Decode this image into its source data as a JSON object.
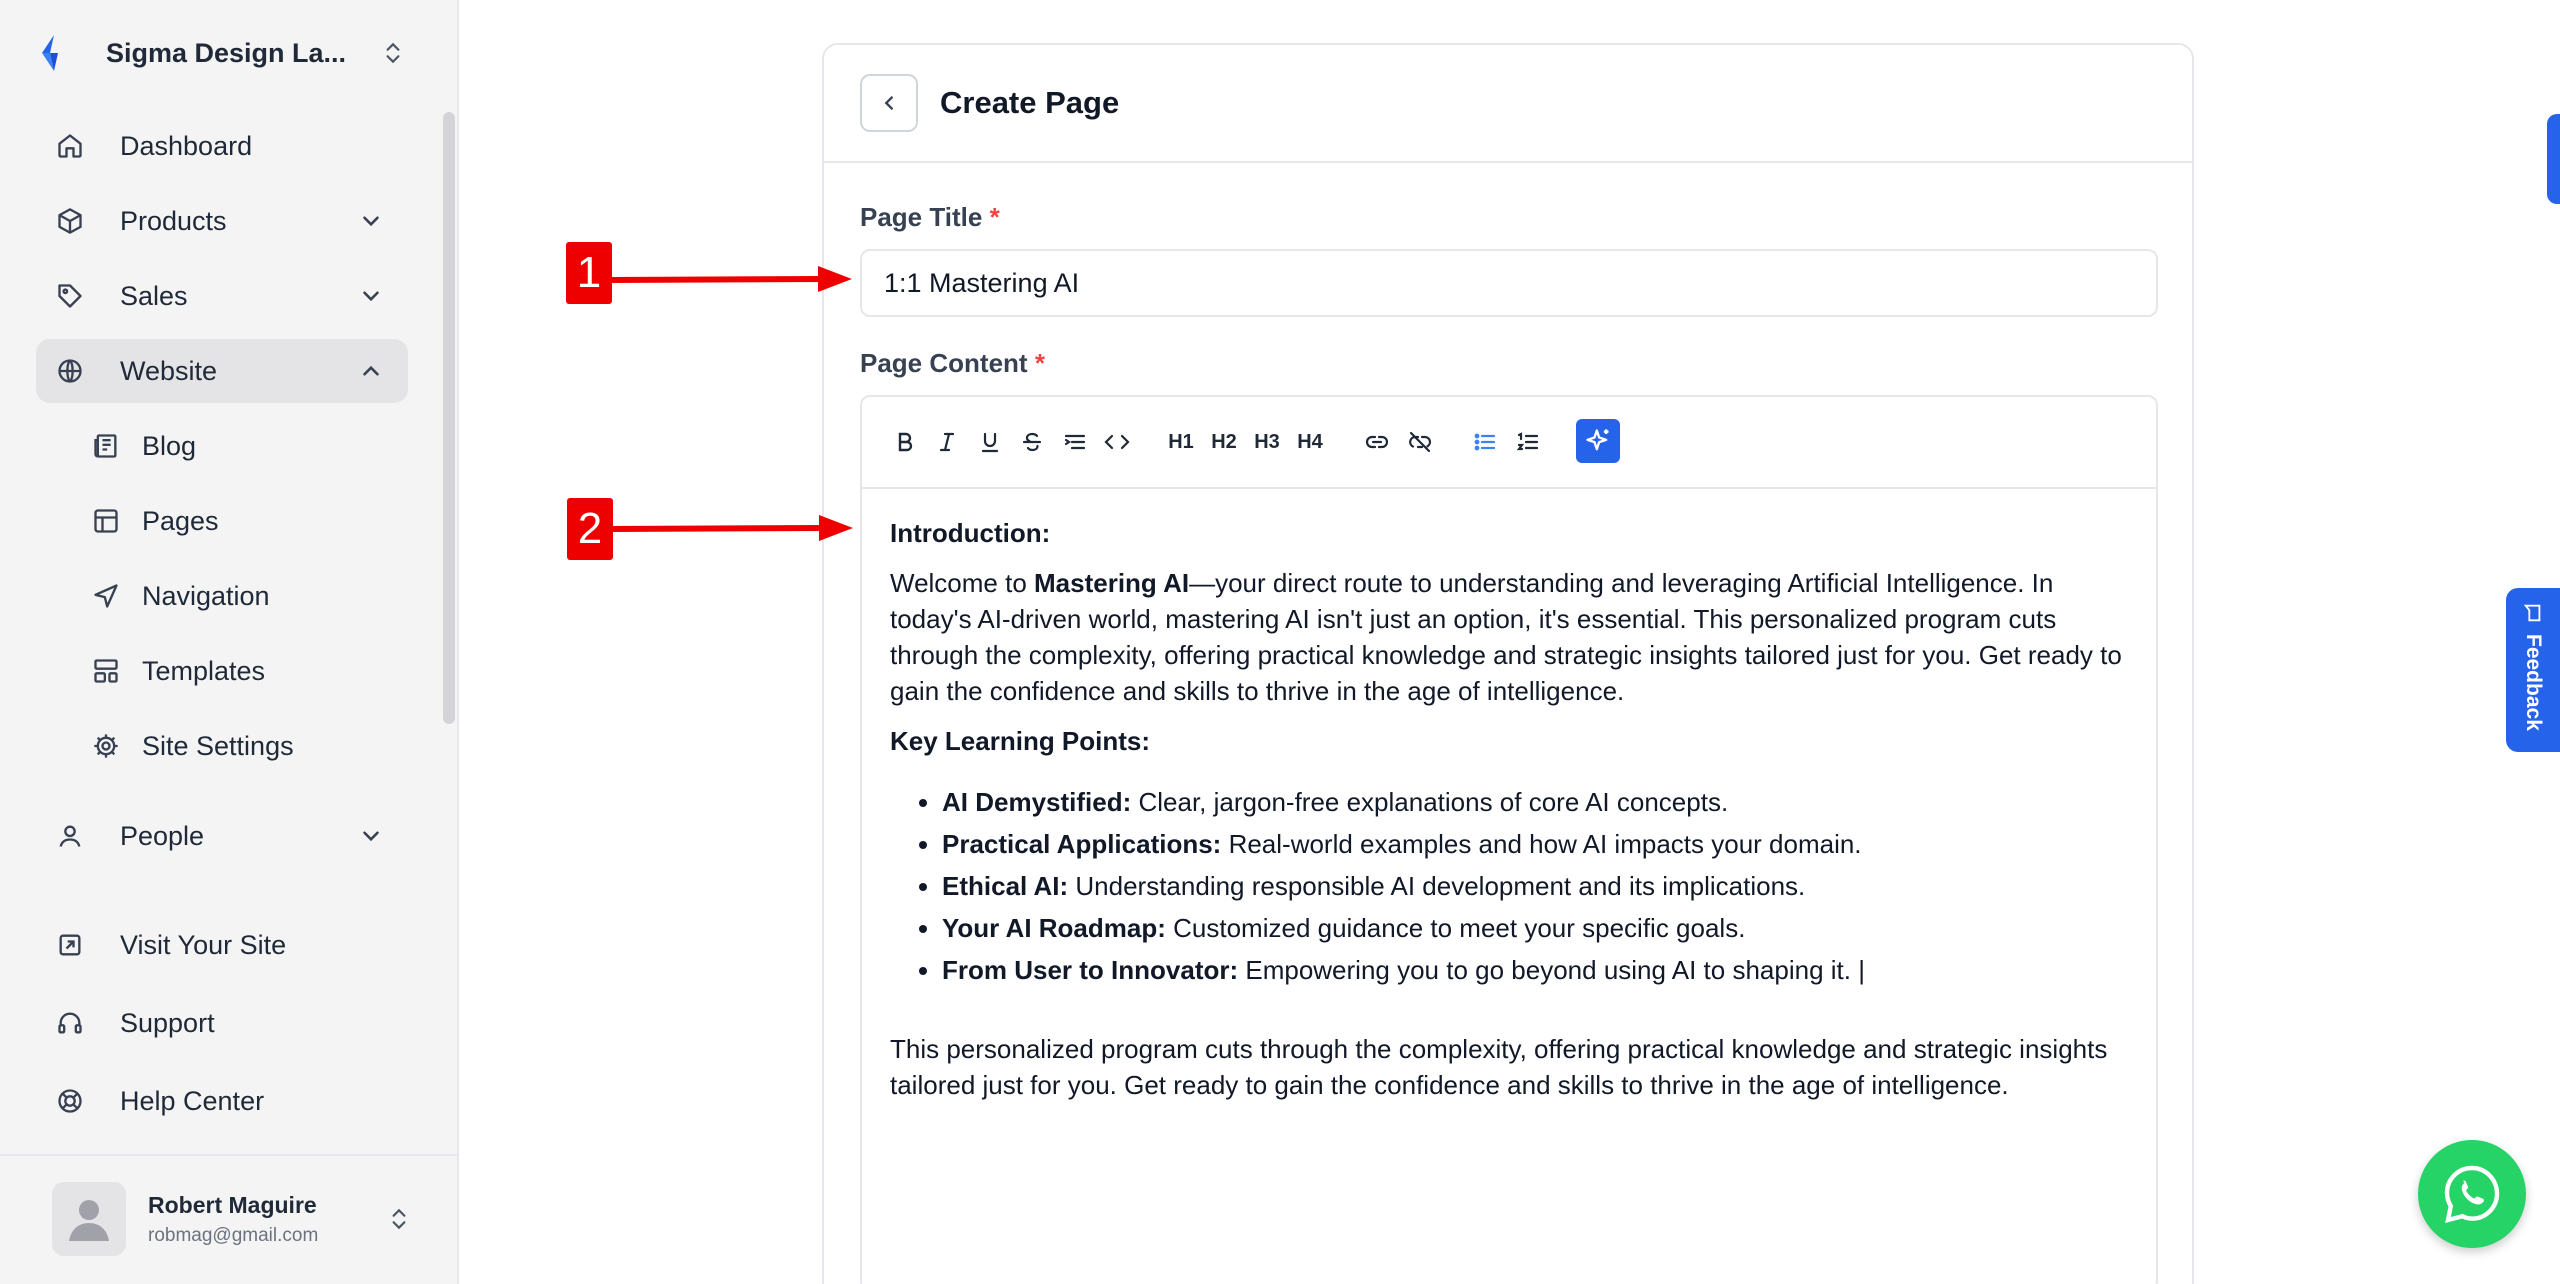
{
  "workspace": {
    "name": "Sigma Design La..."
  },
  "sidebar": {
    "nav": [
      {
        "label": "Dashboard",
        "icon": "home-icon"
      },
      {
        "label": "Products",
        "icon": "box-icon"
      },
      {
        "label": "Sales",
        "icon": "tag-icon"
      },
      {
        "label": "Website",
        "icon": "globe-icon",
        "active": true
      },
      {
        "label": "People",
        "icon": "user-icon"
      }
    ],
    "website_sub": [
      {
        "label": "Blog",
        "icon": "newspaper-icon"
      },
      {
        "label": "Pages",
        "icon": "layout-icon"
      },
      {
        "label": "Navigation",
        "icon": "send-icon"
      },
      {
        "label": "Templates",
        "icon": "template-icon"
      },
      {
        "label": "Site Settings",
        "icon": "gear-icon"
      }
    ],
    "bottom": [
      {
        "label": "Visit Your Site",
        "icon": "external-link-icon"
      },
      {
        "label": "Support",
        "icon": "headset-icon"
      },
      {
        "label": "Help Center",
        "icon": "lifebuoy-icon"
      }
    ],
    "profile": {
      "name": "Robert Maguire",
      "email": "robmag@gmail.com"
    }
  },
  "page": {
    "title": "Create Page",
    "title_label": "Page Title",
    "title_value": "1:1 Mastering AI",
    "content_label": "Page Content",
    "required_mark": "*"
  },
  "editor": {
    "toolbar": [
      "bold",
      "italic",
      "underline",
      "strikethrough",
      "indent",
      "code",
      "H1",
      "H2",
      "H3",
      "H4",
      "link",
      "unlink",
      "bullet-list",
      "ordered-list",
      "ai-assist"
    ],
    "heading_labels": {
      "h1": "H1",
      "h2": "H2",
      "h3": "H3",
      "h4": "H4"
    },
    "intro_heading": "Introduction:",
    "intro_lead": "Welcome to ",
    "intro_bold": "Mastering AI",
    "intro_rest": "—your direct route to understanding and leveraging Artificial Intelligence. In today's AI-driven world, mastering AI isn't just an option, it's essential. This personalized program cuts through the complexity, offering practical knowledge and strategic insights tailored just for you. Get ready to gain the confidence and skills to thrive in the age of intelligence.",
    "key_heading": "Key Learning Points:",
    "points": [
      {
        "bold": "AI Demystified:",
        "text": " Clear, jargon-free explanations of core AI concepts."
      },
      {
        "bold": "Practical Applications:",
        "text": " Real-world examples and how AI impacts your domain."
      },
      {
        "bold": "Ethical AI:",
        "text": " Understanding responsible AI development and its implications."
      },
      {
        "bold": "Your AI Roadmap:",
        "text": " Customized guidance to meet your specific goals."
      },
      {
        "bold": "From User to Innovator:",
        "text": " Empowering you to go beyond using AI to shaping it. |"
      }
    ],
    "closing": "This personalized program cuts through the complexity, offering practical knowledge and strategic insights tailored just for you. Get ready to gain the confidence and skills to thrive in the age of intelligence."
  },
  "annotations": {
    "marker_1": "1",
    "marker_2": "2",
    "color": "#ee0000"
  },
  "widgets": {
    "feedback_label": "Feedback"
  }
}
